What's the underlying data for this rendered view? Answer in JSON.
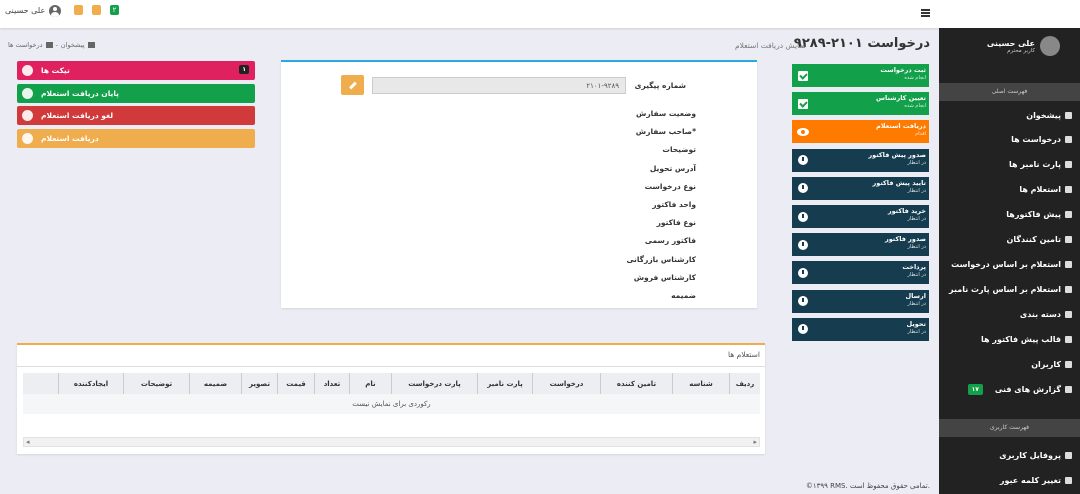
{
  "topbar": {
    "user_name": "علی حسینی",
    "badge_count": "۲"
  },
  "breadcrumb": {
    "home": "پیشخوان",
    "separator": "-",
    "current": "درخواست ها"
  },
  "page": {
    "title": "درخواست ۲۱۰۱-۹۲۸۹",
    "subtitle": "نمایش دریافت استعلام"
  },
  "sidebar": {
    "user_name": "علی حسینی",
    "user_role": "کاربر محترم",
    "main_menu_title": "فهرست اصلی",
    "items": [
      {
        "label": "پیشخوان",
        "icon": "dashboard-icon"
      },
      {
        "label": "درخواست ها",
        "icon": "users-icon"
      },
      {
        "label": "پارت نامبر ها",
        "icon": "database-icon"
      },
      {
        "label": "استعلام ها",
        "icon": "hand-icon"
      },
      {
        "label": "پیش فاکتورها",
        "icon": "list-icon"
      },
      {
        "label": "تامین کنندگان",
        "icon": "user-tie-icon"
      },
      {
        "label": "استعلام بر اساس درخواست",
        "icon": "list-icon"
      },
      {
        "label": "استعلام بر اساس پارت نامبر",
        "icon": "list-icon"
      },
      {
        "label": "دسته بندی",
        "icon": "book-icon"
      },
      {
        "label": "قالب پیش فاکتور ها",
        "icon": "list-icon"
      },
      {
        "label": "کاربران",
        "icon": "users-icon"
      },
      {
        "label": "گزارش های فنی",
        "icon": "bug-icon",
        "badge": "۱۷"
      }
    ],
    "user_menu_title": "فهرست کاربری",
    "user_items": [
      {
        "label": "پروفایل کاربری",
        "icon": "user-icon"
      },
      {
        "label": "تغییر کلمه عبور",
        "icon": "user-icon"
      }
    ]
  },
  "steps": [
    {
      "title": "ثبت درخواست",
      "status": "انجام شده",
      "icon": "check-icon",
      "color": "#13a04a"
    },
    {
      "title": "تعیین کارشناس",
      "status": "انجام شده",
      "icon": "check-icon",
      "color": "#13a04a"
    },
    {
      "title": "دریافت استعلام",
      "status": "اقدام",
      "icon": "eye-icon",
      "color": "#ff7b00"
    },
    {
      "title": "صدور پیش فاکتور",
      "status": "در انتظار",
      "icon": "clock-icon",
      "color": "#153d4f"
    },
    {
      "title": "تایید پیش فاکتور",
      "status": "در انتظار",
      "icon": "clock-icon",
      "color": "#153d4f"
    },
    {
      "title": "خرید فاکتور",
      "status": "در انتظار",
      "icon": "clock-icon",
      "color": "#153d4f"
    },
    {
      "title": "صدور فاکتور",
      "status": "در انتظار",
      "icon": "clock-icon",
      "color": "#153d4f"
    },
    {
      "title": "پرداخت",
      "status": "در انتظار",
      "icon": "clock-icon",
      "color": "#153d4f"
    },
    {
      "title": "ارسال",
      "status": "در انتظار",
      "icon": "clock-icon",
      "color": "#153d4f"
    },
    {
      "title": "تحویل",
      "status": "در انتظار",
      "icon": "clock-icon",
      "color": "#153d4f"
    }
  ],
  "form": {
    "tracking_label": "شماره پیگیری",
    "tracking_value": "۲۱۰۱-۹۲۸۹",
    "fields": [
      "وضعیت سفارش",
      "صاحب سفارش*",
      "توضیحات",
      "آدرس تحویل",
      "نوع درخواست",
      "واحد فاکتور",
      "نوع فاکتور",
      "فاکتور رسمی",
      "کارشناس بازرگانی",
      "کارشناس فروش",
      "ضمیمه"
    ]
  },
  "actions": [
    {
      "label": "تیکت ها",
      "icon": "comments-icon",
      "color": "#e0215f",
      "badge": "۱"
    },
    {
      "label": "پایان دریافت استعلام",
      "icon": "check-icon",
      "color": "#13a04a"
    },
    {
      "label": "لغو دریافت استعلام",
      "icon": "close-icon",
      "color": "#d03a3a"
    },
    {
      "label": "دریافت استعلام",
      "icon": "gear-icon",
      "color": "#f0ad4e"
    }
  ],
  "table": {
    "title": "استعلام ها",
    "columns": [
      "ردیف",
      "شناسه",
      "تامین کننده",
      "درخواست",
      "پارت نامبر",
      "پارت درخواست",
      "نام",
      "تعداد",
      "قیمت",
      "تصویر",
      "ضمیمه",
      "توضیحات",
      "ایجادکننده"
    ],
    "empty_message": "رکوردی برای نمایش نیست"
  },
  "footer": {
    "copyright": "©۱۳۹۹ RMS. تمامی حقوق محفوظ است."
  }
}
